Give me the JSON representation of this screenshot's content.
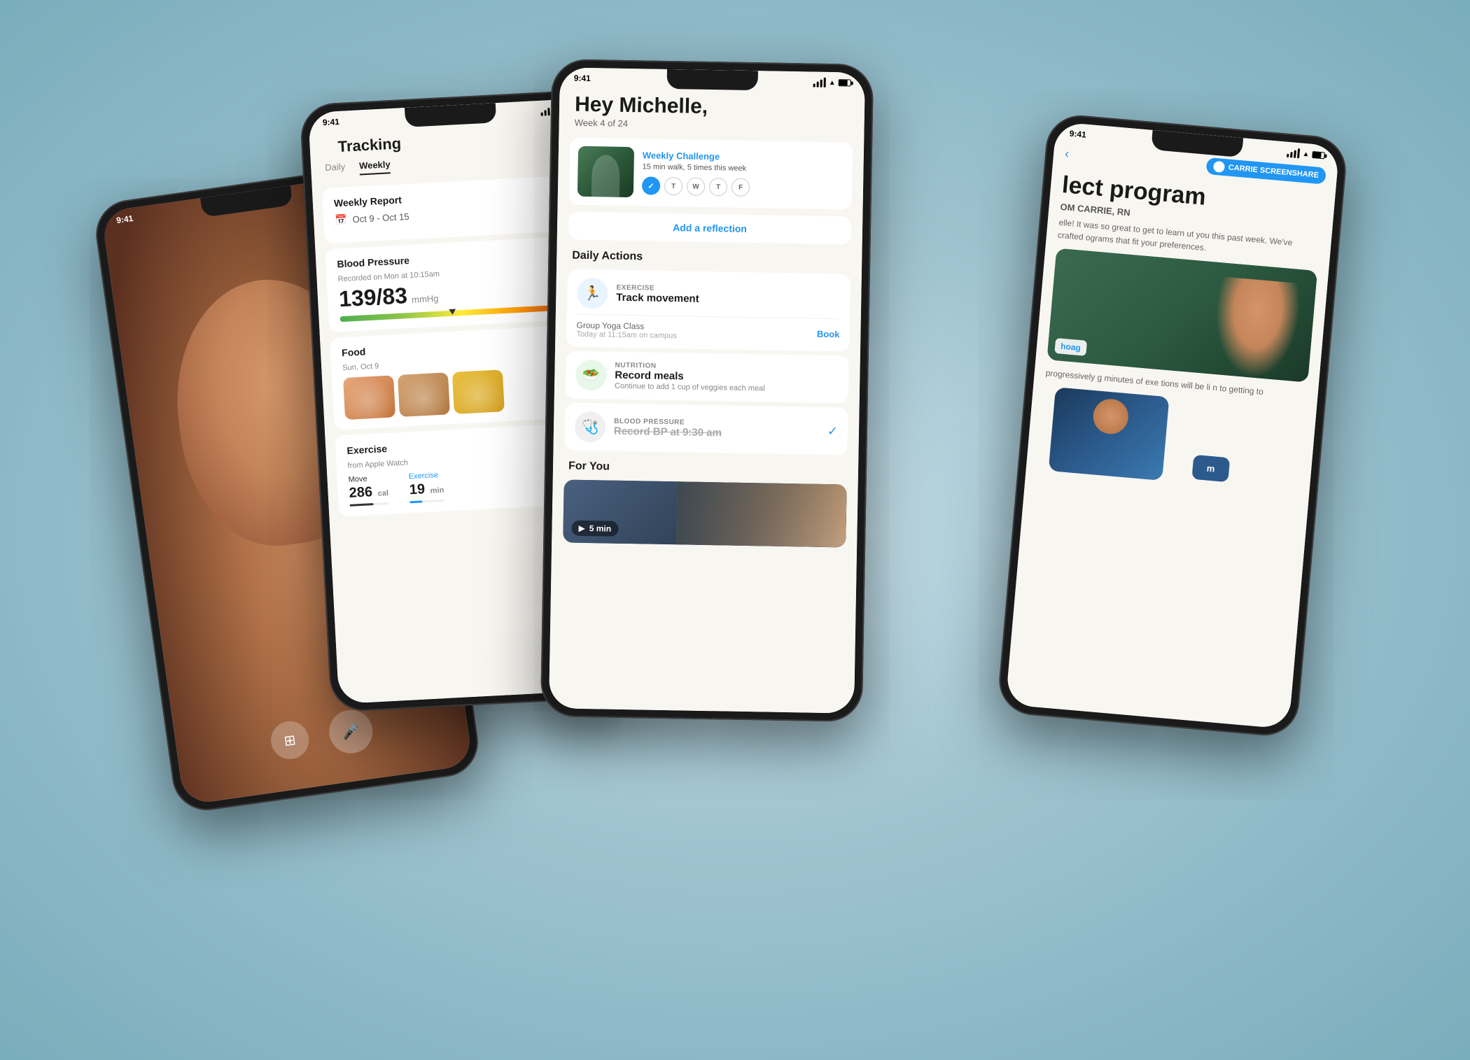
{
  "background_color": "#a0c4d0",
  "phones": {
    "video_call": {
      "time": "9:41",
      "controls": [
        "airplay",
        "mic"
      ]
    },
    "tracking": {
      "time": "9:41",
      "title": "Tracking",
      "tabs": [
        "Daily",
        "Weekly"
      ],
      "active_tab": "Weekly",
      "weekly_report": {
        "label": "Weekly Report",
        "date_range": "Oct 9 - Oct 15"
      },
      "blood_pressure": {
        "label": "Blood Pressure",
        "recorded": "Recorded on Mon at 10:15am",
        "value": "139/83",
        "unit": "mmHg"
      },
      "food": {
        "label": "Food",
        "date": "Sun, Oct 9"
      },
      "exercise": {
        "label": "Exercise",
        "source": "from Apple Watch",
        "move_label": "Move",
        "exercise_label": "Exercise",
        "move_value": "286",
        "move_unit": "cal",
        "exercise_value": "19",
        "exercise_unit": "min"
      }
    },
    "home": {
      "time": "9:41",
      "greeting": "Hey Michelle,",
      "week": "Week 4 of 24",
      "weekly_challenge": {
        "title": "Weekly Challenge",
        "description": "15 min walk, 5 times this week",
        "days": [
          "✓",
          "T",
          "W",
          "T",
          "F"
        ],
        "days_status": [
          true,
          false,
          false,
          false,
          false
        ]
      },
      "add_reflection": "Add a reflection",
      "daily_actions_label": "Daily Actions",
      "actions": [
        {
          "category": "EXERCISE",
          "name": "Track movement",
          "desc": "",
          "sub_text": "Group Yoga Class",
          "sub_detail": "Today at 11:15am on campus",
          "sub_action": "Book",
          "icon": "🏃",
          "type": "exercise"
        },
        {
          "category": "NUTRITION",
          "name": "Record meals",
          "desc": "Continue to add 1 cup of veggies each meal",
          "icon": "🥗",
          "type": "nutrition"
        },
        {
          "category": "BLOOD PRESSURE",
          "name": "Record BP at 9:30 am",
          "desc": "",
          "icon": "🩺",
          "type": "bp",
          "completed": true
        }
      ],
      "for_you_label": "For You",
      "for_you_time": "5 min"
    },
    "program": {
      "time": "9:41",
      "back_label": "‹",
      "screenshare_label": "CARRIE SCREENSHARE",
      "title": "lect program",
      "from_label": "OM CARRIE, RN",
      "message": "elle! It was so great to get to learn ut you this past week. We've crafted ograms that fit your preferences.",
      "description": "progressively g minutes of exe tions will be li n to getting to",
      "start_label": "m",
      "hoag_label": "hoag"
    }
  }
}
